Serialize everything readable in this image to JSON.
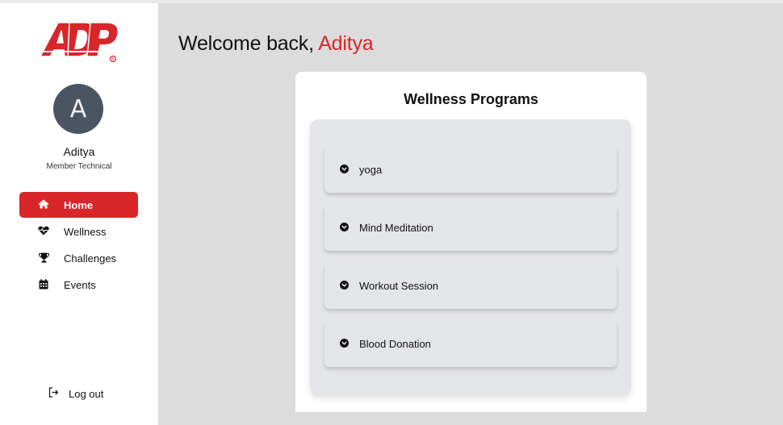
{
  "brand": {
    "logo_text": "ADP",
    "accent_color": "#d8262b"
  },
  "user": {
    "initial": "A",
    "name": "Aditya",
    "role": "Member Technical"
  },
  "nav": {
    "items": [
      {
        "label": "Home",
        "icon": "home-icon",
        "active": true
      },
      {
        "label": "Wellness",
        "icon": "heartbeat-icon",
        "active": false
      },
      {
        "label": "Challenges",
        "icon": "trophy-icon",
        "active": false
      },
      {
        "label": "Events",
        "icon": "calendar-icon",
        "active": false
      }
    ],
    "logout_label": "Log out"
  },
  "header": {
    "greeting": "Welcome back, ",
    "name": "Aditya"
  },
  "wellness": {
    "title": "Wellness Programs",
    "programs": [
      {
        "label": "yoga"
      },
      {
        "label": "Mind Meditation"
      },
      {
        "label": "Workout Session"
      },
      {
        "label": "Blood Donation"
      }
    ]
  }
}
